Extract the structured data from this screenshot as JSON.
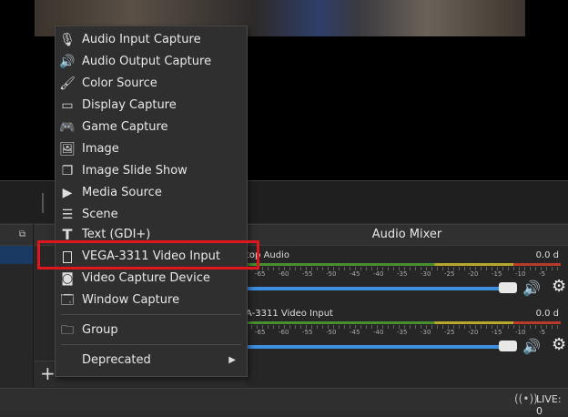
{
  "menu": {
    "items": [
      {
        "label": "Audio Input Capture",
        "icon": "microphone-icon",
        "glyph": "🎙"
      },
      {
        "label": "Audio Output Capture",
        "icon": "speaker-icon",
        "glyph": "🔊"
      },
      {
        "label": "Color Source",
        "icon": "brush-icon",
        "glyph": "🖌"
      },
      {
        "label": "Display Capture",
        "icon": "monitor-icon",
        "glyph": "🖵"
      },
      {
        "label": "Game Capture",
        "icon": "gamepad-icon",
        "glyph": "🎮"
      },
      {
        "label": "Image",
        "icon": "image-icon",
        "glyph": "🖼"
      },
      {
        "label": "Image Slide Show",
        "icon": "slideshow-icon",
        "glyph": "🗇"
      },
      {
        "label": "Media Source",
        "icon": "play-icon",
        "glyph": "▶"
      },
      {
        "label": "Scene",
        "icon": "list-icon",
        "glyph": "☰"
      },
      {
        "label": "Text (GDI+)",
        "icon": "text-icon",
        "glyph": "T"
      },
      {
        "label": "VEGA-3311 Video Input",
        "icon": "document-icon",
        "glyph": ""
      },
      {
        "label": "Video Capture Device",
        "icon": "camera-icon",
        "glyph": "📷"
      },
      {
        "label": "Window Capture",
        "icon": "window-icon",
        "glyph": "🗔"
      }
    ],
    "group_label": "Group",
    "group_icon": "folder-icon",
    "deprecated_label": "Deprecated",
    "deprecated_arrow": "▶"
  },
  "mixer": {
    "title": "Audio Mixer",
    "tracks": [
      {
        "name": "Desktop Audio",
        "visible_name": "top Audio",
        "db": "0.0 d"
      },
      {
        "name": "VEGA-3311 Video Input",
        "visible_name": "A-3311 Video Input",
        "db": "0.0 d"
      }
    ],
    "ticks": [
      "-65",
      "-60",
      "-55",
      "-50",
      "-45",
      "-40",
      "-35",
      "-30",
      "-25",
      "-20",
      "-15",
      "-10",
      "-5"
    ]
  },
  "sources": {
    "add_label": "+"
  },
  "status": {
    "live_label": "LIVE: 0"
  },
  "colors": {
    "highlight": "#e0161d",
    "slider": "#3d8fe0",
    "selection": "#1b3a63"
  }
}
